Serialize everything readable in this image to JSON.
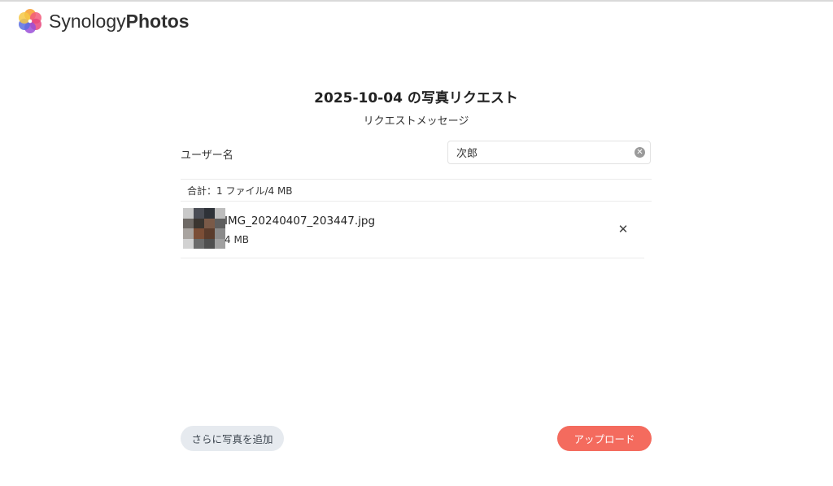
{
  "brand": {
    "name_light": "Synology",
    "name_bold": "Photos"
  },
  "request": {
    "title": "2025-10-04 の写真リクエスト",
    "message": "リクエストメッセージ"
  },
  "form": {
    "user_label": "ユーザー名",
    "user_value": "次郎",
    "clear_glyph": "✕"
  },
  "summary": {
    "text": "合計：1 ファイル/4 MB"
  },
  "files": [
    {
      "name": "IMG_20240407_203447.jpg",
      "size": "4 MB",
      "remove_glyph": "✕"
    }
  ],
  "actions": {
    "add_more_label": "さらに写真を追加",
    "upload_label": "アップロード"
  },
  "colors": {
    "accent": "#f46b5e",
    "secondary_button": "#e6eaef"
  },
  "icons": {
    "logo": "synology-photos-flower-icon",
    "clear": "clear-circle-icon",
    "remove": "close-icon"
  }
}
